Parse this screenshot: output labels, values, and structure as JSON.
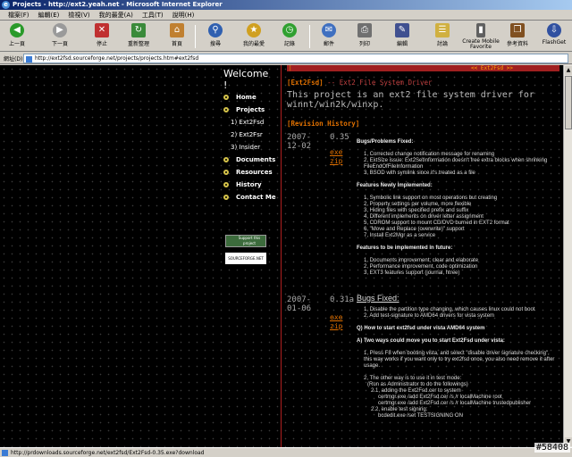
{
  "window": {
    "title": "Projects - http://ext2.yeah.net - Microsoft Internet Explorer"
  },
  "menu": [
    "檔案(F)",
    "編輯(E)",
    "檢視(V)",
    "我的最愛(A)",
    "工具(T)",
    "說明(H)"
  ],
  "toolbar": [
    {
      "label": "上一頁",
      "icon": "back-icon",
      "color": "#2a9a2a"
    },
    {
      "label": "下一頁",
      "icon": "forward-icon",
      "color": "#9a9a9a"
    },
    {
      "label": "停止",
      "icon": "stop-icon",
      "color": "#c03030"
    },
    {
      "label": "重新整理",
      "icon": "refresh-icon",
      "color": "#3a8a3a"
    },
    {
      "label": "首頁",
      "icon": "home-icon",
      "color": "#c08030"
    },
    {
      "label": "搜尋",
      "icon": "search-icon",
      "color": "#3060b0"
    },
    {
      "label": "我的最愛",
      "icon": "favorites-icon",
      "color": "#d0a020"
    },
    {
      "label": "記錄",
      "icon": "history-icon",
      "color": "#30a030"
    },
    {
      "label": "郵件",
      "icon": "mail-icon",
      "color": "#4070c0"
    },
    {
      "label": "列印",
      "icon": "print-icon",
      "color": "#707070"
    },
    {
      "label": "編輯",
      "icon": "edit-icon",
      "color": "#405090"
    },
    {
      "label": "討論",
      "icon": "discuss-icon",
      "color": "#d0b040"
    },
    {
      "label": "Create Mobile Favorite",
      "icon": "mobile-favorite-icon",
      "color": "#606060"
    },
    {
      "label": "參考資料",
      "icon": "research-icon",
      "color": "#805020"
    },
    {
      "label": "FlashGet",
      "icon": "flashget-icon",
      "color": "#3050a0"
    }
  ],
  "address": {
    "label": "網址(D)",
    "url": "http://ext2fsd.sourceforge.net/projects/projects.htm#ext2fsd"
  },
  "nav": {
    "welcome": "Welcome !",
    "items": [
      "Home",
      "Projects",
      "Documents",
      "Resources",
      "History",
      "Contact Me"
    ],
    "subitems": [
      "1) Ext2Fsd",
      "2) Ext2Fsr",
      "3) Insider"
    ],
    "support_badge": "Support this project",
    "sf_badge": "SOURCEFORGE.NET"
  },
  "main": {
    "strip_left": "|",
    "strip_right": "<< Ext2Fsd >>",
    "project": "[Ext2Fsd]",
    "project_sub": "-- Ext2 File System Driver",
    "description": "This project is an ext2 file system driver for winnt/win2k/winxp.",
    "rev_heading": "[Revision History]",
    "rev1": {
      "date": "2007-12-02",
      "version": "0.35",
      "links": [
        "exe",
        "zip"
      ],
      "sections": [
        {
          "heading": "Bugs/Problems Fixed:",
          "items": [
            "1, Corrected change notification message for renaming",
            "2, ExtSize issue: Ext2SetInformation doesn't free extra blocks when shrinking FileEndOfFileInformation",
            "3, BSOD with symlink since it's treated as a file"
          ]
        },
        {
          "heading": "Features Newly Implemented:",
          "items": [
            "1, Symbolic link support on most operations but creating",
            "2, Property settings per volume, more flexible",
            "3, Hiding files with specified prefix and suffix",
            "4, Different implements on driver letter assignment",
            "5, CDROM support to mount CD/DVD burned in EXT2 format",
            "6, \"Move and Replace (overwrite)\" support",
            "7, Install Ext2Mgr as a service"
          ]
        },
        {
          "heading": "Features to be implemented in future:",
          "items": [
            "1, Documents improvement: clear and elaborate",
            "2, Performance improvement, code optimization",
            "3, EXT3 features support (journal, htree)"
          ]
        }
      ]
    },
    "rev2": {
      "date": "2007-01-06",
      "version": "0.31a",
      "links": [
        "exe",
        "zip"
      ],
      "bugs_heading": "Bugs Fixed:",
      "bugs": [
        "1, Disable the partition type changing, which causes linux could not boot",
        "2, Add test-signature to AMD64 drivers for vista system"
      ],
      "q_heading": "Q) How to start ext2fsd under vista AMD64 system",
      "a_heading": "A) Two ways could move you to start Ext2Fsd under vista:",
      "lines": [
        "1, Press F8 when booting vista, and select \"disable driver signature checking\", this way works if you want only to try ext2fsd once, you also need remove it after usage.",
        "",
        "2, The other way is to use it in test mode:",
        "(Run as Administrator to do the followings)",
        "2.1, adding the Ext2Fsd.cer to system",
        "certmgr.exe /add Ext2Fsd.cer /s /r localMachine root",
        "certmgr.exe /add Ext2Fsd.cer /s /r localMachine trustedpublisher",
        "2.2, enable test signing:",
        "bcdedit.exe /set TESTSIGNING ON"
      ]
    }
  },
  "status": {
    "text": "http://prdownloads.sourceforge.net/ext2fsd/Ext2Fsd-0.35.exe?download"
  },
  "watermark": "#58408"
}
